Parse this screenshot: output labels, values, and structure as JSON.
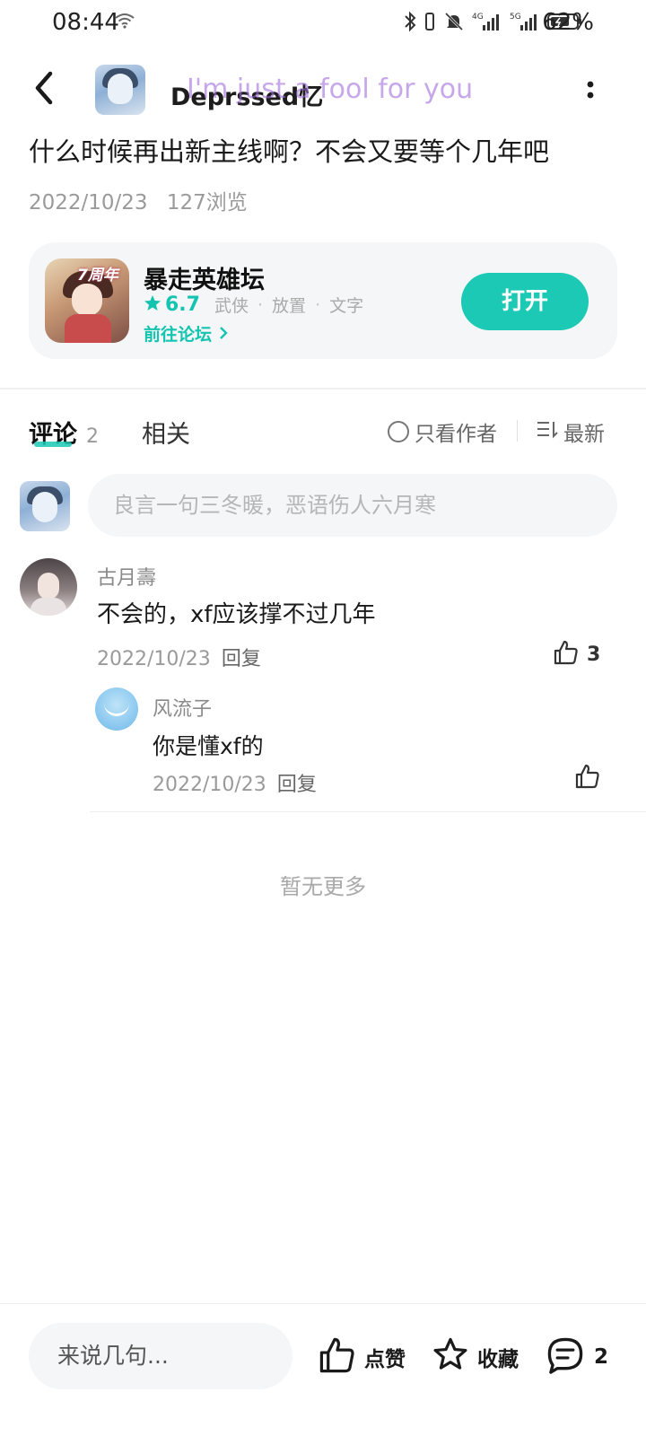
{
  "status_bar": {
    "time": "08:44",
    "battery": "62%",
    "icons": [
      "wifi-icon",
      "bluetooth-icon",
      "vibrate-icon",
      "mute-bell-icon",
      "signal-4g-icon",
      "signal-5g-icon",
      "battery-icon"
    ]
  },
  "header": {
    "username": "Deprssed忆",
    "overlay_text": "I'm just a fool for you",
    "icons": [
      "back-arrow-icon",
      "more-vertical-icon"
    ]
  },
  "post": {
    "title": "什么时候再出新主线啊？不会又要等个几年吧",
    "date": "2022/10/23",
    "views": "127浏览"
  },
  "forum_card": {
    "name": "暴走英雄坛",
    "badge": "7周年",
    "rating": "6.7",
    "tags": [
      "武侠",
      "放置",
      "文字"
    ],
    "link_label": "前往论坛",
    "open_label": "打开",
    "accent_color": "#1cc9b4"
  },
  "tabs": {
    "comments_label": "评论",
    "comments_count": "2",
    "related_label": "相关",
    "author_only_label": "只看作者",
    "sort_label": "最新"
  },
  "comment_input": {
    "placeholder": "良言一句三冬暖，恶语伤人六月寒"
  },
  "comments": [
    {
      "name": "古月壽",
      "text": "不会的，xf应该撑不过几年",
      "date": "2022/10/23",
      "reply_label": "回复",
      "likes": "3",
      "replies": [
        {
          "name": "风流子",
          "text": "你是懂xf的",
          "date": "2022/10/23",
          "reply_label": "回复"
        }
      ]
    }
  ],
  "no_more_text": "暂无更多",
  "bottom_bar": {
    "input_placeholder": "来说几句...",
    "like_label": "点赞",
    "favorite_label": "收藏",
    "comment_count": "2"
  }
}
